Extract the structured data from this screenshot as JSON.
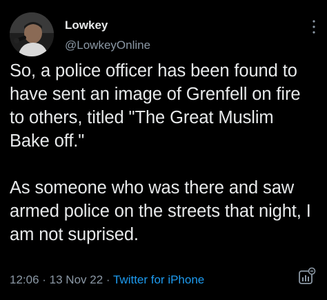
{
  "tweet": {
    "author": {
      "display_name": "Lowkey",
      "handle": "@LowkeyOnline"
    },
    "paragraphs": [
      "So, a police officer has been found to have sent an image of Grenfell on fire to others, titled \"The Great Muslim Bake off.\"",
      "As someone who was there and saw armed police on the streets that night, I am not suprised."
    ],
    "meta": {
      "time": "12:06",
      "separator_1": " · ",
      "date": "13 Nov 22",
      "separator_2": " · ",
      "source": "Twitter for iPhone"
    }
  },
  "icons": {
    "more": "more-vertical-icon",
    "analytics": "analytics-icon"
  },
  "colors": {
    "background": "#000000",
    "text_primary": "#e7e9ea",
    "text_secondary": "#8b98a5",
    "link": "#1d9bf0"
  }
}
